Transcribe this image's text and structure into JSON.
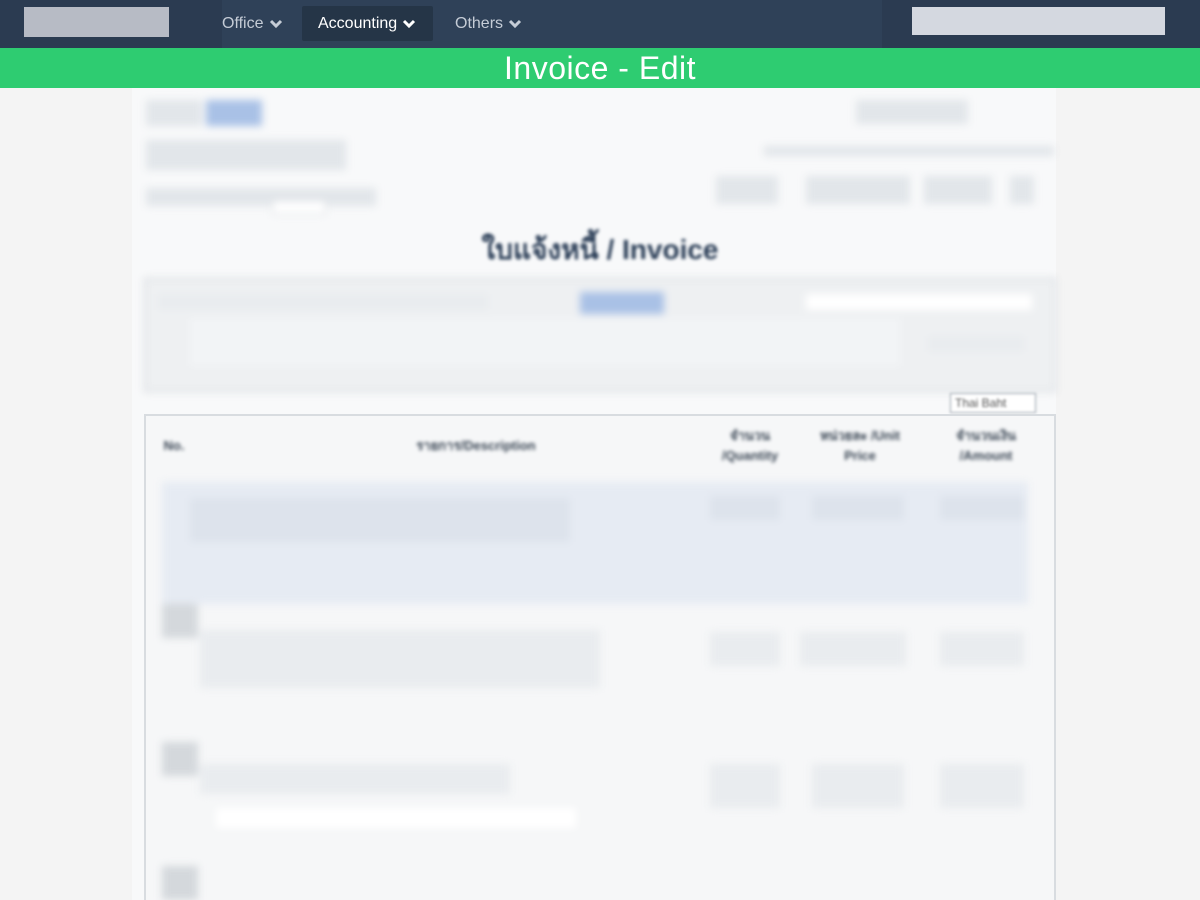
{
  "nav": {
    "items": [
      {
        "label": "Office",
        "active": false
      },
      {
        "label": "Accounting",
        "active": true
      },
      {
        "label": "Others",
        "active": false
      }
    ]
  },
  "banner": {
    "title": "Invoice - Edit"
  },
  "document": {
    "title": "ใบแจ้งหนี้ / Invoice"
  },
  "currency": {
    "selected": "Thai Baht"
  },
  "table": {
    "columns": [
      {
        "label": "No."
      },
      {
        "label": "รายการ/Description"
      },
      {
        "label": "จำนวน /Quantity"
      },
      {
        "label": "หน่วยละ /Unit Price"
      },
      {
        "label": "จำนวนเงิน /Amount"
      }
    ]
  },
  "colors": {
    "navbar": "#2f4158",
    "banner": "#2ecc71",
    "title_text": "#2b3e57",
    "highlight_row": "#e6ebf3"
  }
}
